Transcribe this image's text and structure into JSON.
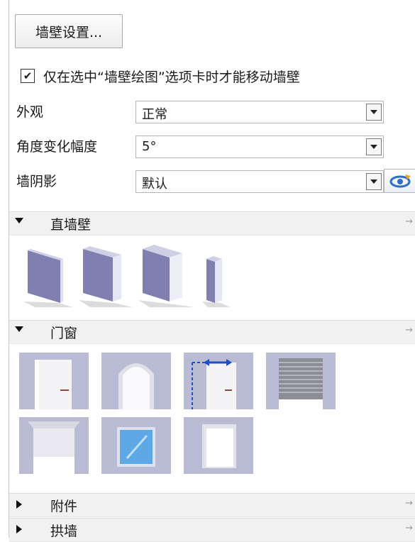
{
  "toolbar": {
    "wall_settings_label": "墙壁设置..."
  },
  "options": {
    "move_walls_checkbox": {
      "checked": true,
      "mark": "✔",
      "label": "仅在选中“墙壁绘图”选项卡时才能移动墙壁"
    }
  },
  "properties": [
    {
      "label": "外观",
      "value": "正常"
    },
    {
      "label": "角度变化幅度",
      "value": "5°"
    },
    {
      "label": "墙阴影",
      "value": "默认"
    }
  ],
  "sections": {
    "straight_walls": {
      "title": "直墙壁",
      "expanded": true
    },
    "doors_windows": {
      "title": "门窗",
      "expanded": true
    },
    "accessories": {
      "title": "附件",
      "expanded": false
    },
    "arch_walls": {
      "title": "拱墙",
      "expanded": false
    }
  },
  "pin_glyph": "→",
  "colors": {
    "tile_bg": "#b9bad3",
    "wall_face": "#7f80b0",
    "wall_side": "#dedff0",
    "accent_arrow": "#1e4fc8"
  }
}
